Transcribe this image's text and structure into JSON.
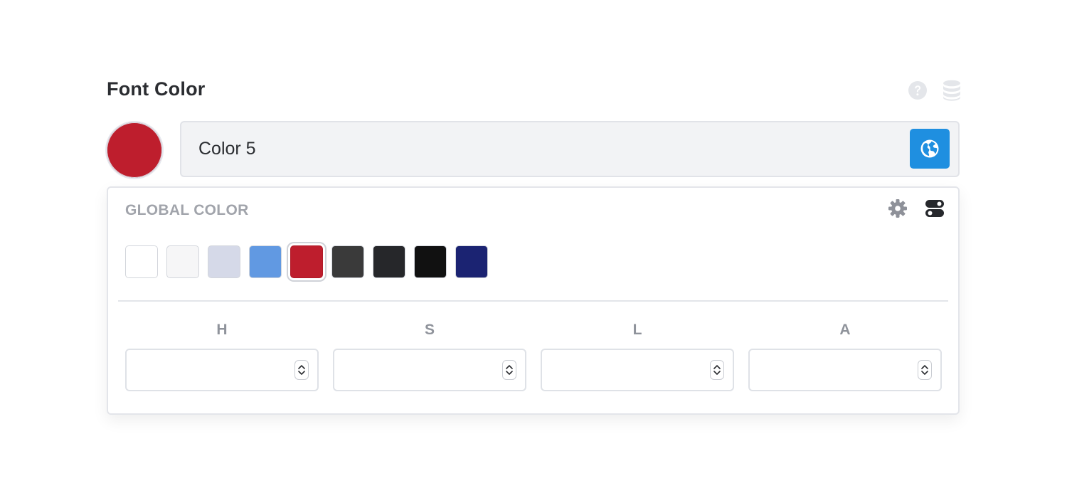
{
  "control": {
    "title": "Font Color",
    "help_icon": "question-circle-icon",
    "database_icon": "database-icon"
  },
  "current": {
    "value": "Color 5",
    "swatch_color": "#be1e2d",
    "globe_icon": "globe-icon",
    "globe_button_color": "#1f8fe0"
  },
  "panel": {
    "heading": "GLOBAL COLOR",
    "settings_icon": "gear-icon",
    "toggle_icon": "toggle-icon",
    "palette": [
      {
        "color": "#ffffff"
      },
      {
        "color": "#f6f6f7"
      },
      {
        "color": "#d5d9e8"
      },
      {
        "color": "#6199e2"
      },
      {
        "color": "#be1e2d",
        "selected": true
      },
      {
        "color": "#3a3a3a"
      },
      {
        "color": "#26272a"
      },
      {
        "color": "#111111"
      },
      {
        "color": "#1b2372"
      }
    ],
    "channels": [
      {
        "label": "H",
        "value": ""
      },
      {
        "label": "S",
        "value": ""
      },
      {
        "label": "L",
        "value": ""
      },
      {
        "label": "A",
        "value": ""
      }
    ]
  }
}
